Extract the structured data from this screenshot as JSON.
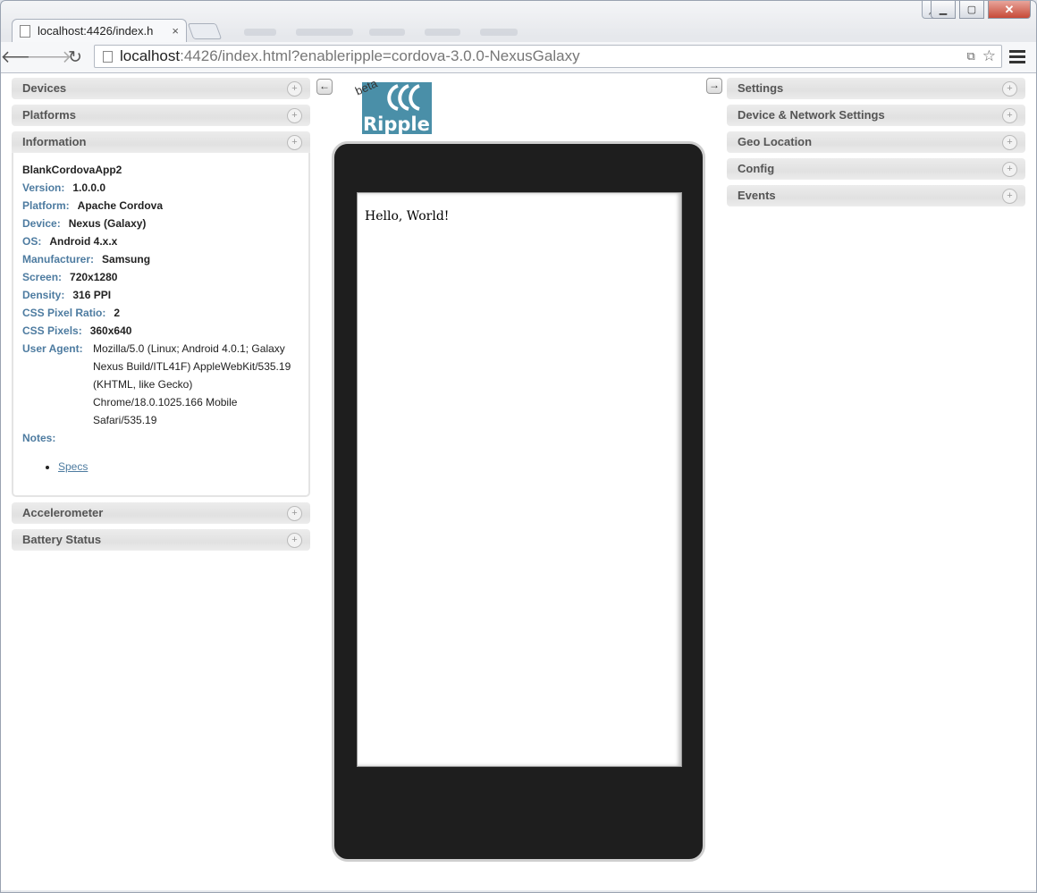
{
  "browser": {
    "tab_title": "localhost:4426/index.h",
    "tab_close": "×",
    "url_host": "localhost",
    "url_rest": ":4426/index.html?enableripple=cordova-3.0.0-NexusGalaxy"
  },
  "left_panels": {
    "devices": "Devices",
    "platforms": "Platforms",
    "information": "Information",
    "accelerometer": "Accelerometer",
    "battery_status": "Battery Status"
  },
  "info": {
    "app_name": "BlankCordovaApp2",
    "version_label": "Version:",
    "version": "1.0.0.0",
    "platform_label": "Platform:",
    "platform": "Apache Cordova",
    "device_label": "Device:",
    "device": "Nexus (Galaxy)",
    "os_label": "OS:",
    "os": "Android 4.x.x",
    "manufacturer_label": "Manufacturer:",
    "manufacturer": "Samsung",
    "screen_label": "Screen:",
    "screen": "720x1280",
    "density_label": "Density:",
    "density": "316 PPI",
    "css_ratio_label": "CSS Pixel Ratio:",
    "css_ratio": "2",
    "css_pixels_label": "CSS Pixels:",
    "css_pixels": "360x640",
    "user_agent_label": "User Agent:",
    "user_agent": "Mozilla/5.0 (Linux; Android 4.0.1; Galaxy Nexus Build/ITL41F) AppleWebKit/535.19 (KHTML, like Gecko) Chrome/18.0.1025.166 Mobile Safari/535.19",
    "notes_label": "Notes:",
    "specs_link": "Specs"
  },
  "right_panels": {
    "settings": "Settings",
    "device_network": "Device & Network Settings",
    "geo_location": "Geo Location",
    "config": "Config",
    "events": "Events"
  },
  "emulator": {
    "beta": "beta",
    "logo_text": "Ripple",
    "screen_text": "Hello, World!"
  },
  "icons": {
    "collapse_left": "arrow-left-icon",
    "collapse_right": "arrow-right-icon",
    "panel_expand": "plus-icon"
  }
}
